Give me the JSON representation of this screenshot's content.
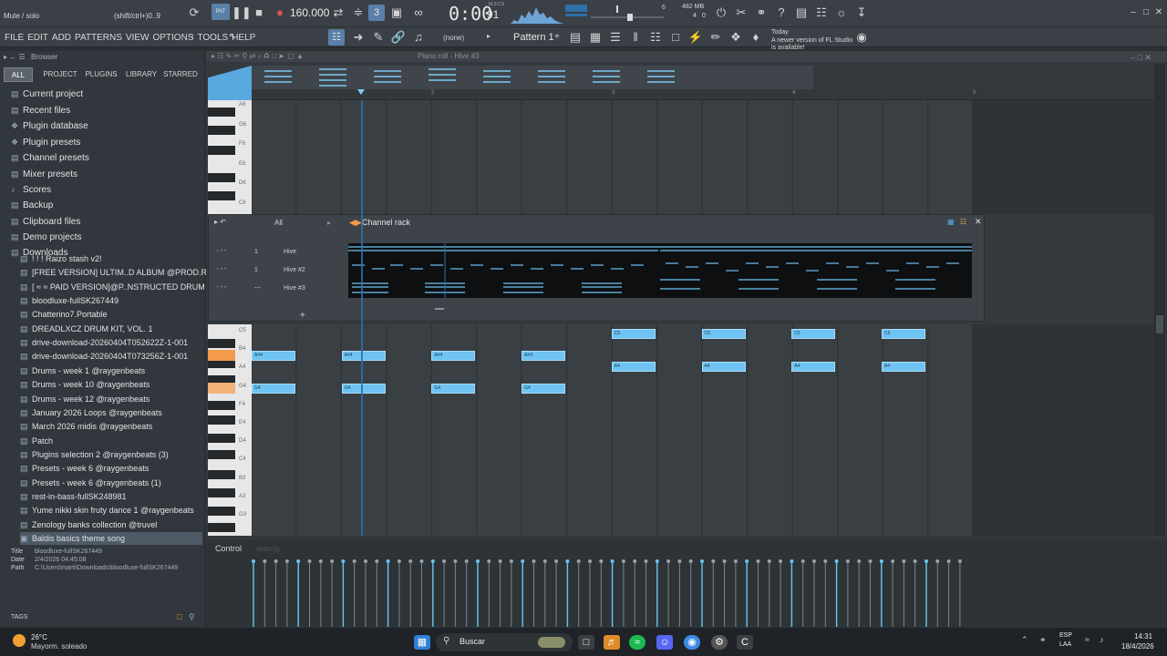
{
  "topbar": {
    "hint": "Mute / solo",
    "shortcut": "(shift/ctrl+)0..9",
    "tempo": "160.000",
    "time": "0:00",
    "time_frac": "91",
    "time_unit": "M:S:CS",
    "cpu_mem": "482 MB",
    "cpu_num": "6",
    "poly": "4",
    "poly2": "0",
    "pattern_label": "Pattern 1",
    "none_label": "(none)",
    "news_day": "Today",
    "news_text": "A newer version of FL Studio is available!"
  },
  "menubar": {
    "items": [
      "FILE",
      "EDIT",
      "ADD",
      "PATTERNS",
      "VIEW",
      "OPTIONS",
      "TOOLS",
      "HELP"
    ]
  },
  "browser": {
    "title": "Browser",
    "tabs": [
      "ALL",
      "PROJECT",
      "PLUGINS",
      "LIBRARY",
      "STARRED"
    ],
    "folders": [
      "Current project",
      "Recent files",
      "Plugin database",
      "Plugin presets",
      "Channel presets",
      "Mixer presets",
      "Scores",
      "Backup",
      "Clipboard files",
      "Demo projects",
      "Downloads"
    ],
    "downloads": [
      "! ! ! Raizo stash v2!",
      "[FREE VERSION] ULTIM..D ALBUM @PROD.ROSEY$",
      "[ ≈ ≈ PAID VERSION]@P..NSTRUCTED DRUM KIT",
      "bloodluxe-fullSK267449",
      "Chatterino7.Portable",
      "DREADLXCZ DRUM KIT, VOL. 1",
      "drive-download-20260404T052622Z-1-001",
      "drive-download-20260404T073256Z-1-001",
      "Drums - week 1 @raygenbeats",
      "Drums - week 10 @raygenbeats",
      "Drums - week 12 @raygenbeats",
      "January 2026 Loops @raygenbeats",
      "March 2026 midis @raygenbeats",
      "Patch",
      "Plugins selection 2 @raygenbeats (3)",
      "Presets - week 6 @raygenbeats",
      "Presets - week 6 @raygenbeats (1)",
      "rest-in-bass-fullSK248981",
      "Yume nikki skin fruty dance 1 @raygenbeats",
      "Zenology banks collection @truvel",
      "Baldis basics theme song"
    ],
    "info": {
      "title_k": "Title",
      "title_v": "bloodluxe-fullSK267449",
      "date_k": "Date",
      "date_v": "2/4/2026 04:45:08",
      "path_k": "Path",
      "path_v": "C:\\Users\\marti\\Downloads\\bloodluxe-fullSK267449"
    },
    "tags": "TAGS"
  },
  "pianoroll": {
    "title": "Piano roll - Hive #3",
    "bar_numbers": [
      "2",
      "3",
      "4",
      "5"
    ],
    "top_keys": [
      "A6",
      "G6",
      "F6",
      "E6",
      "D6",
      "C6"
    ],
    "bottom_keys": [
      "C5",
      "B4",
      "A4",
      "G4",
      "F4",
      "E4",
      "D4",
      "C4",
      "B3",
      "A3",
      "G3"
    ],
    "control_label": "Control",
    "control_sub": "Velocity"
  },
  "notes": [
    {
      "label": "A#4",
      "row": "a4s",
      "bar": 0
    },
    {
      "label": "A#4",
      "row": "a4s",
      "bar": 1
    },
    {
      "label": "A#4",
      "row": "a4s",
      "bar": 2
    },
    {
      "label": "A#4",
      "row": "a4s",
      "bar": 3
    },
    {
      "label": "G4",
      "row": "g4",
      "bar": 0
    },
    {
      "label": "G4",
      "row": "g4",
      "bar": 1
    },
    {
      "label": "G4",
      "row": "g4",
      "bar": 2
    },
    {
      "label": "G4",
      "row": "g4",
      "bar": 3
    },
    {
      "label": "C5",
      "row": "c5",
      "bar": 4
    },
    {
      "label": "C5",
      "row": "c5",
      "bar": 5
    },
    {
      "label": "C5",
      "row": "c5",
      "bar": 6
    },
    {
      "label": "C5",
      "row": "c5",
      "bar": 7
    },
    {
      "label": "A4",
      "row": "a4",
      "bar": 4
    },
    {
      "label": "A4",
      "row": "a4",
      "bar": 5
    },
    {
      "label": "A4",
      "row": "a4",
      "bar": 6
    },
    {
      "label": "A4",
      "row": "a4",
      "bar": 7
    }
  ],
  "channelrack": {
    "title": "Channel rack",
    "filter": "All",
    "channels": [
      {
        "name": "Hive",
        "num": "1"
      },
      {
        "name": "Hive #2",
        "num": "1"
      },
      {
        "name": "Hive #3",
        "num": "---"
      }
    ]
  },
  "taskbar": {
    "temp": "26°C",
    "weather": "Mayorm. soleado",
    "search": "Buscar",
    "lang1": "ESP",
    "lang2": "LAA",
    "clock_time": "14:31",
    "clock_date": "18/4/2026"
  },
  "colors": {
    "note": "#6ec3f2",
    "accent_orange": "#f39a4c",
    "playhead": "#2f6fa8"
  }
}
